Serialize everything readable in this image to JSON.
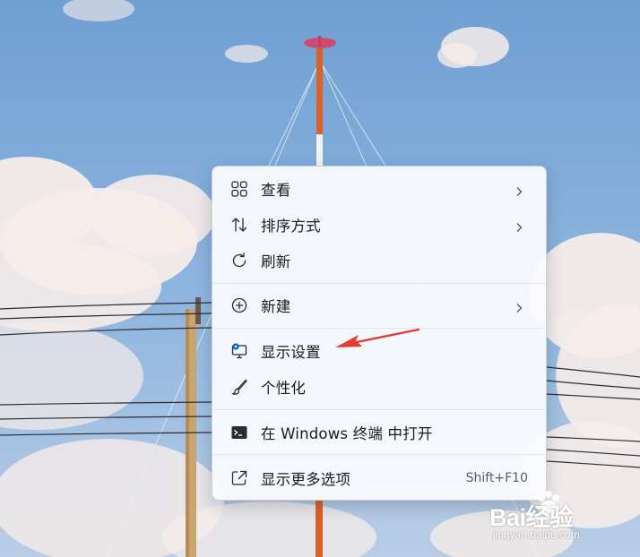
{
  "menu": {
    "items": [
      {
        "label": "查看",
        "icon": "grid-view-icon",
        "has_submenu": true
      },
      {
        "label": "排序方式",
        "icon": "sort-arrows-icon",
        "has_submenu": true
      },
      {
        "label": "刷新",
        "icon": "refresh-icon",
        "has_submenu": false
      },
      {
        "label": "新建",
        "icon": "add-circle-icon",
        "has_submenu": true
      },
      {
        "label": "显示设置",
        "icon": "display-settings-icon",
        "has_submenu": false
      },
      {
        "label": "个性化",
        "icon": "paintbrush-icon",
        "has_submenu": false
      },
      {
        "label": "在 Windows 终端 中打开",
        "icon": "terminal-icon",
        "has_submenu": false
      },
      {
        "label": "显示更多选项",
        "icon": "show-more-options-icon",
        "shortcut": "Shift+F10"
      }
    ]
  },
  "watermark": {
    "brand": "Bai经验",
    "url": "jingyan.baidu.com"
  },
  "colors": {
    "annotation_arrow": "#e8392f",
    "accent": "#0067c0"
  }
}
